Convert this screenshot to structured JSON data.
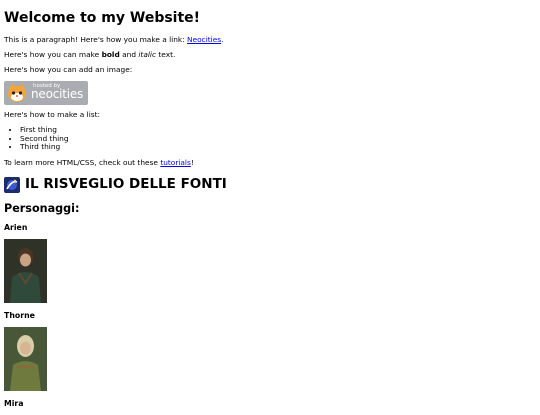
{
  "intro": {
    "heading": "Welcome to my Website!",
    "p1_text": "This is a paragraph! Here's how you make a link: ",
    "p1_link": "Neocities",
    "p1_end": ".",
    "p2_text": "Here's how you can make ",
    "p2_bold": "bold",
    "p2_mid": " and ",
    "p2_italic": "italic",
    "p2_end": " text.",
    "p3_text": "Here's how you can add an image:",
    "badge_small": "hosted by",
    "badge_big": "neocities",
    "list_intro": "Here's how to make a list:",
    "list_items": [
      "First thing",
      "Second thing",
      "Third thing"
    ],
    "learn_text": "To learn more HTML/CSS, check out these ",
    "learn_link": "tutorials",
    "learn_end": "!"
  },
  "game": {
    "title": "IL RISVEGLIO DELLE FONTI",
    "characters_heading": "Personaggi:",
    "characters": [
      {
        "name": "Arien",
        "icon": "portrait-arien"
      },
      {
        "name": "Thorne",
        "icon": "portrait-thorne"
      },
      {
        "name": "Mira",
        "icon": "portrait-mira"
      }
    ]
  },
  "colors": {
    "link": "#0000ee",
    "badge_bg": "#a9adb1"
  }
}
